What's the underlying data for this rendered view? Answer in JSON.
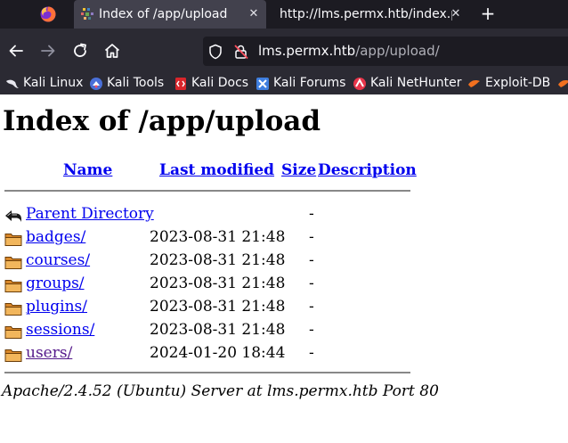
{
  "browser": {
    "tabs": [
      {
        "title": "Index of /app/upload",
        "active": true
      },
      {
        "title": "http://lms.permx.htb/index.php",
        "active": false
      }
    ],
    "new_tab_symbol": "+",
    "tab_close_symbol": "✕",
    "url": {
      "host": "lms.permx.htb",
      "path": "/app/upload/"
    },
    "bookmarks": [
      {
        "label": "Kali Linux",
        "icon": "kali-dragon-icon"
      },
      {
        "label": "Kali Tools",
        "icon": "kali-tools-icon"
      },
      {
        "label": "Kali Docs",
        "icon": "kali-docs-icon"
      },
      {
        "label": "Kali Forums",
        "icon": "kali-forums-icon"
      },
      {
        "label": "Kali NetHunter",
        "icon": "kali-nethunter-icon"
      },
      {
        "label": "Exploit-DB",
        "icon": "exploit-db-icon"
      }
    ],
    "colors": {
      "tabbar": "#1c1b22",
      "toolbar": "#2b2a33",
      "active_tab": "#42414d",
      "text": "#fbfbfe"
    }
  },
  "page": {
    "title": "Index of /app/upload",
    "columns": {
      "name": "Name",
      "last_modified": "Last modified",
      "size": "Size",
      "description": "Description"
    },
    "parent": {
      "name": "Parent Directory",
      "size": "-"
    },
    "entries": [
      {
        "name": "badges/",
        "modified": "2023-08-31 21:48",
        "size": "-",
        "visited": false
      },
      {
        "name": "courses/",
        "modified": "2023-08-31 21:48",
        "size": "-",
        "visited": false
      },
      {
        "name": "groups/",
        "modified": "2023-08-31 21:48",
        "size": "-",
        "visited": false
      },
      {
        "name": "plugins/",
        "modified": "2023-08-31 21:48",
        "size": "-",
        "visited": false
      },
      {
        "name": "sessions/",
        "modified": "2023-08-31 21:48",
        "size": "-",
        "visited": false
      },
      {
        "name": "users/",
        "modified": "2024-01-20 18:44",
        "size": "-",
        "visited": true
      }
    ],
    "footer": "Apache/2.4.52 (Ubuntu) Server at lms.permx.htb Port 80",
    "colors": {
      "link": "#0000ee",
      "visited": "#551a8b",
      "folder": "#e8a33a"
    }
  }
}
